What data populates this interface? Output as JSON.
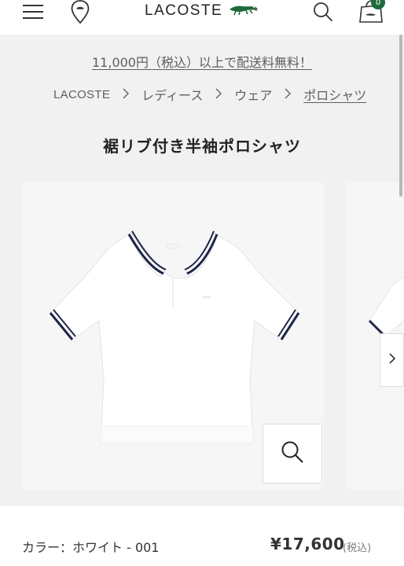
{
  "header": {
    "brand": "LACOSTE",
    "cart_count": "0",
    "icons": [
      "menu-icon",
      "store-locator-icon",
      "crocodile-logo-icon",
      "search-icon",
      "shopping-bag-icon"
    ]
  },
  "promo": {
    "shipping_text": "11,000円（税込）以上で配送料無料！"
  },
  "breadcrumb": {
    "brand": "LACOSTE",
    "items": [
      "レディース",
      "ウェア",
      "ポロシャツ"
    ],
    "separator": ">"
  },
  "product": {
    "title": "裾リブ付き半袖ポロシャツ",
    "color_label": "カラー：ホワイト - 001",
    "price": "¥17,600",
    "tax_note": "(税込)"
  },
  "colors": {
    "accent_green": "#1e6b3c",
    "page_gray": "#f1f1f1",
    "shirt_trim_navy": "#1f2448"
  }
}
